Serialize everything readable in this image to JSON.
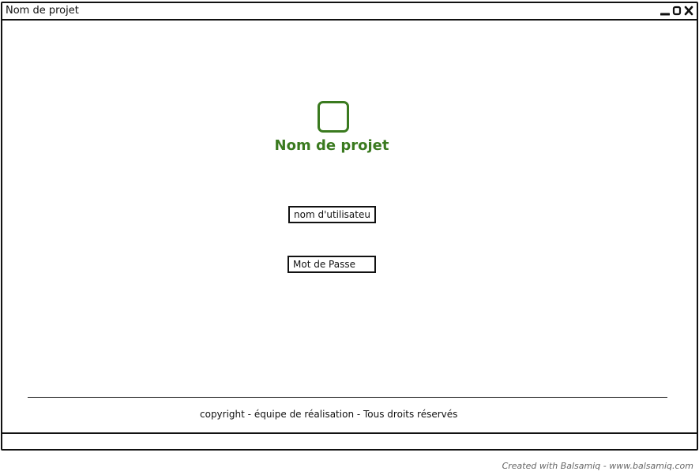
{
  "window": {
    "title": "Nom de projet",
    "controls": [
      "minimize-icon",
      "maximize-icon",
      "close-icon"
    ]
  },
  "header": {
    "logo_icon": "square-logo-icon",
    "project_name": "Nom de projet",
    "accent_color": "#3a7a1f"
  },
  "login": {
    "username_placeholder": "nom d'utilisateur",
    "password_placeholder": "Mot de Passe"
  },
  "footer": {
    "copyright": "copyright - équipe de réalisation - Tous droits réservés"
  },
  "credit": "Created with Balsamiq - www.balsamiq.com"
}
